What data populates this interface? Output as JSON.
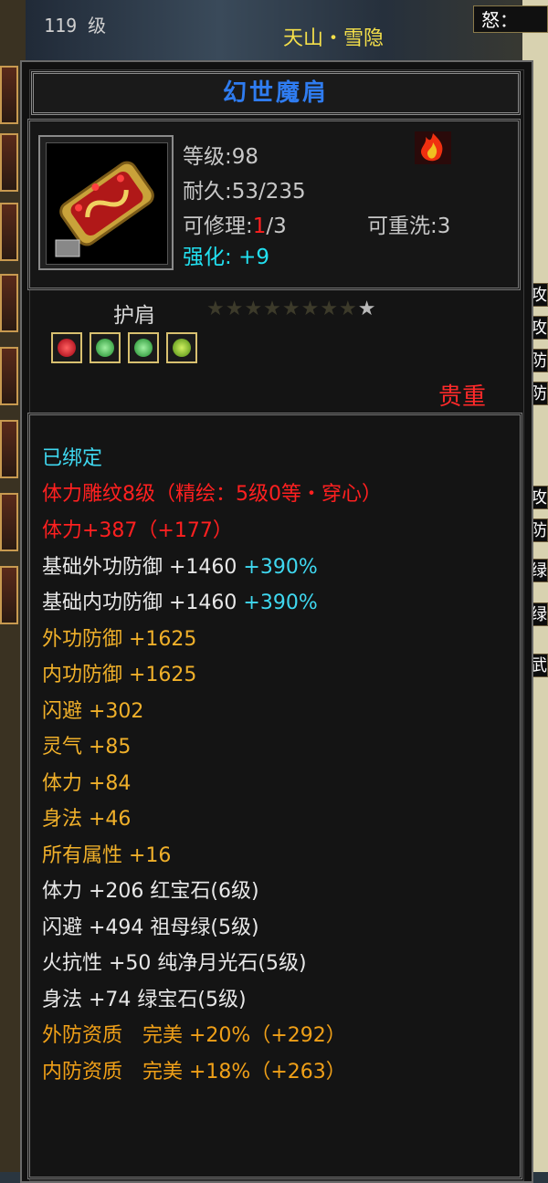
{
  "top": {
    "level": "119 级",
    "player": "天山・雪隐",
    "anger": "怒："
  },
  "item": {
    "name": "幻世魔肩",
    "level": "等级:98",
    "durability": "耐久:53/235",
    "repair_prefix": "可修理:",
    "repair_used": "1",
    "repair_total": "/3",
    "rewash": "可重洗:3",
    "refine_label": "强化:",
    "refine_value": "+9",
    "slot": "护肩",
    "stars": "★★★★★★★★★",
    "stars_dim_count": 8,
    "stars_total": 9,
    "quality": "贵重"
  },
  "right_side": [
    "攻",
    "攻",
    "防",
    "防",
    "攻",
    "防",
    "绿",
    "绿",
    "武"
  ],
  "attributes": {
    "bound": "已绑定",
    "engrave": "体力雕纹8级（精绘：5级0等・穿心）",
    "engrave_stat": "体力+387（+177）",
    "base_ext_def": "基础外功防御 +1460",
    "base_ext_def_pct": "+390%",
    "base_int_def": "基础内功防御 +1460",
    "base_int_def_pct": "+390%",
    "gold_lines": [
      "外功防御 +1625",
      "内功防御 +1625",
      "闪避 +302",
      "灵气 +85",
      "体力 +84",
      "身法 +46",
      "所有属性 +16"
    ],
    "gem_lines": [
      "体力 +206 红宝石(6级)",
      "闪避 +494 祖母绿(5级)",
      "火抗性 +50 纯净月光石(5级)",
      "身法 +74 绿宝石(5级)"
    ],
    "aptitude_lines": [
      "外防资质　完美 +20%（+292）",
      "内防资质　完美 +18%（+263）"
    ]
  },
  "colors": {
    "name": "#2f7cf0",
    "refine": "#22e0f0",
    "quality": "#ff2a2a",
    "gold": "#f0b02a",
    "red": "#ff2020",
    "cyan": "#3fd8f0"
  },
  "icons": [
    "shoulder-item-icon",
    "flame-status-icon",
    "red-gem-icon",
    "green-gem-icon",
    "green-gem-icon",
    "green-gem-icon"
  ]
}
